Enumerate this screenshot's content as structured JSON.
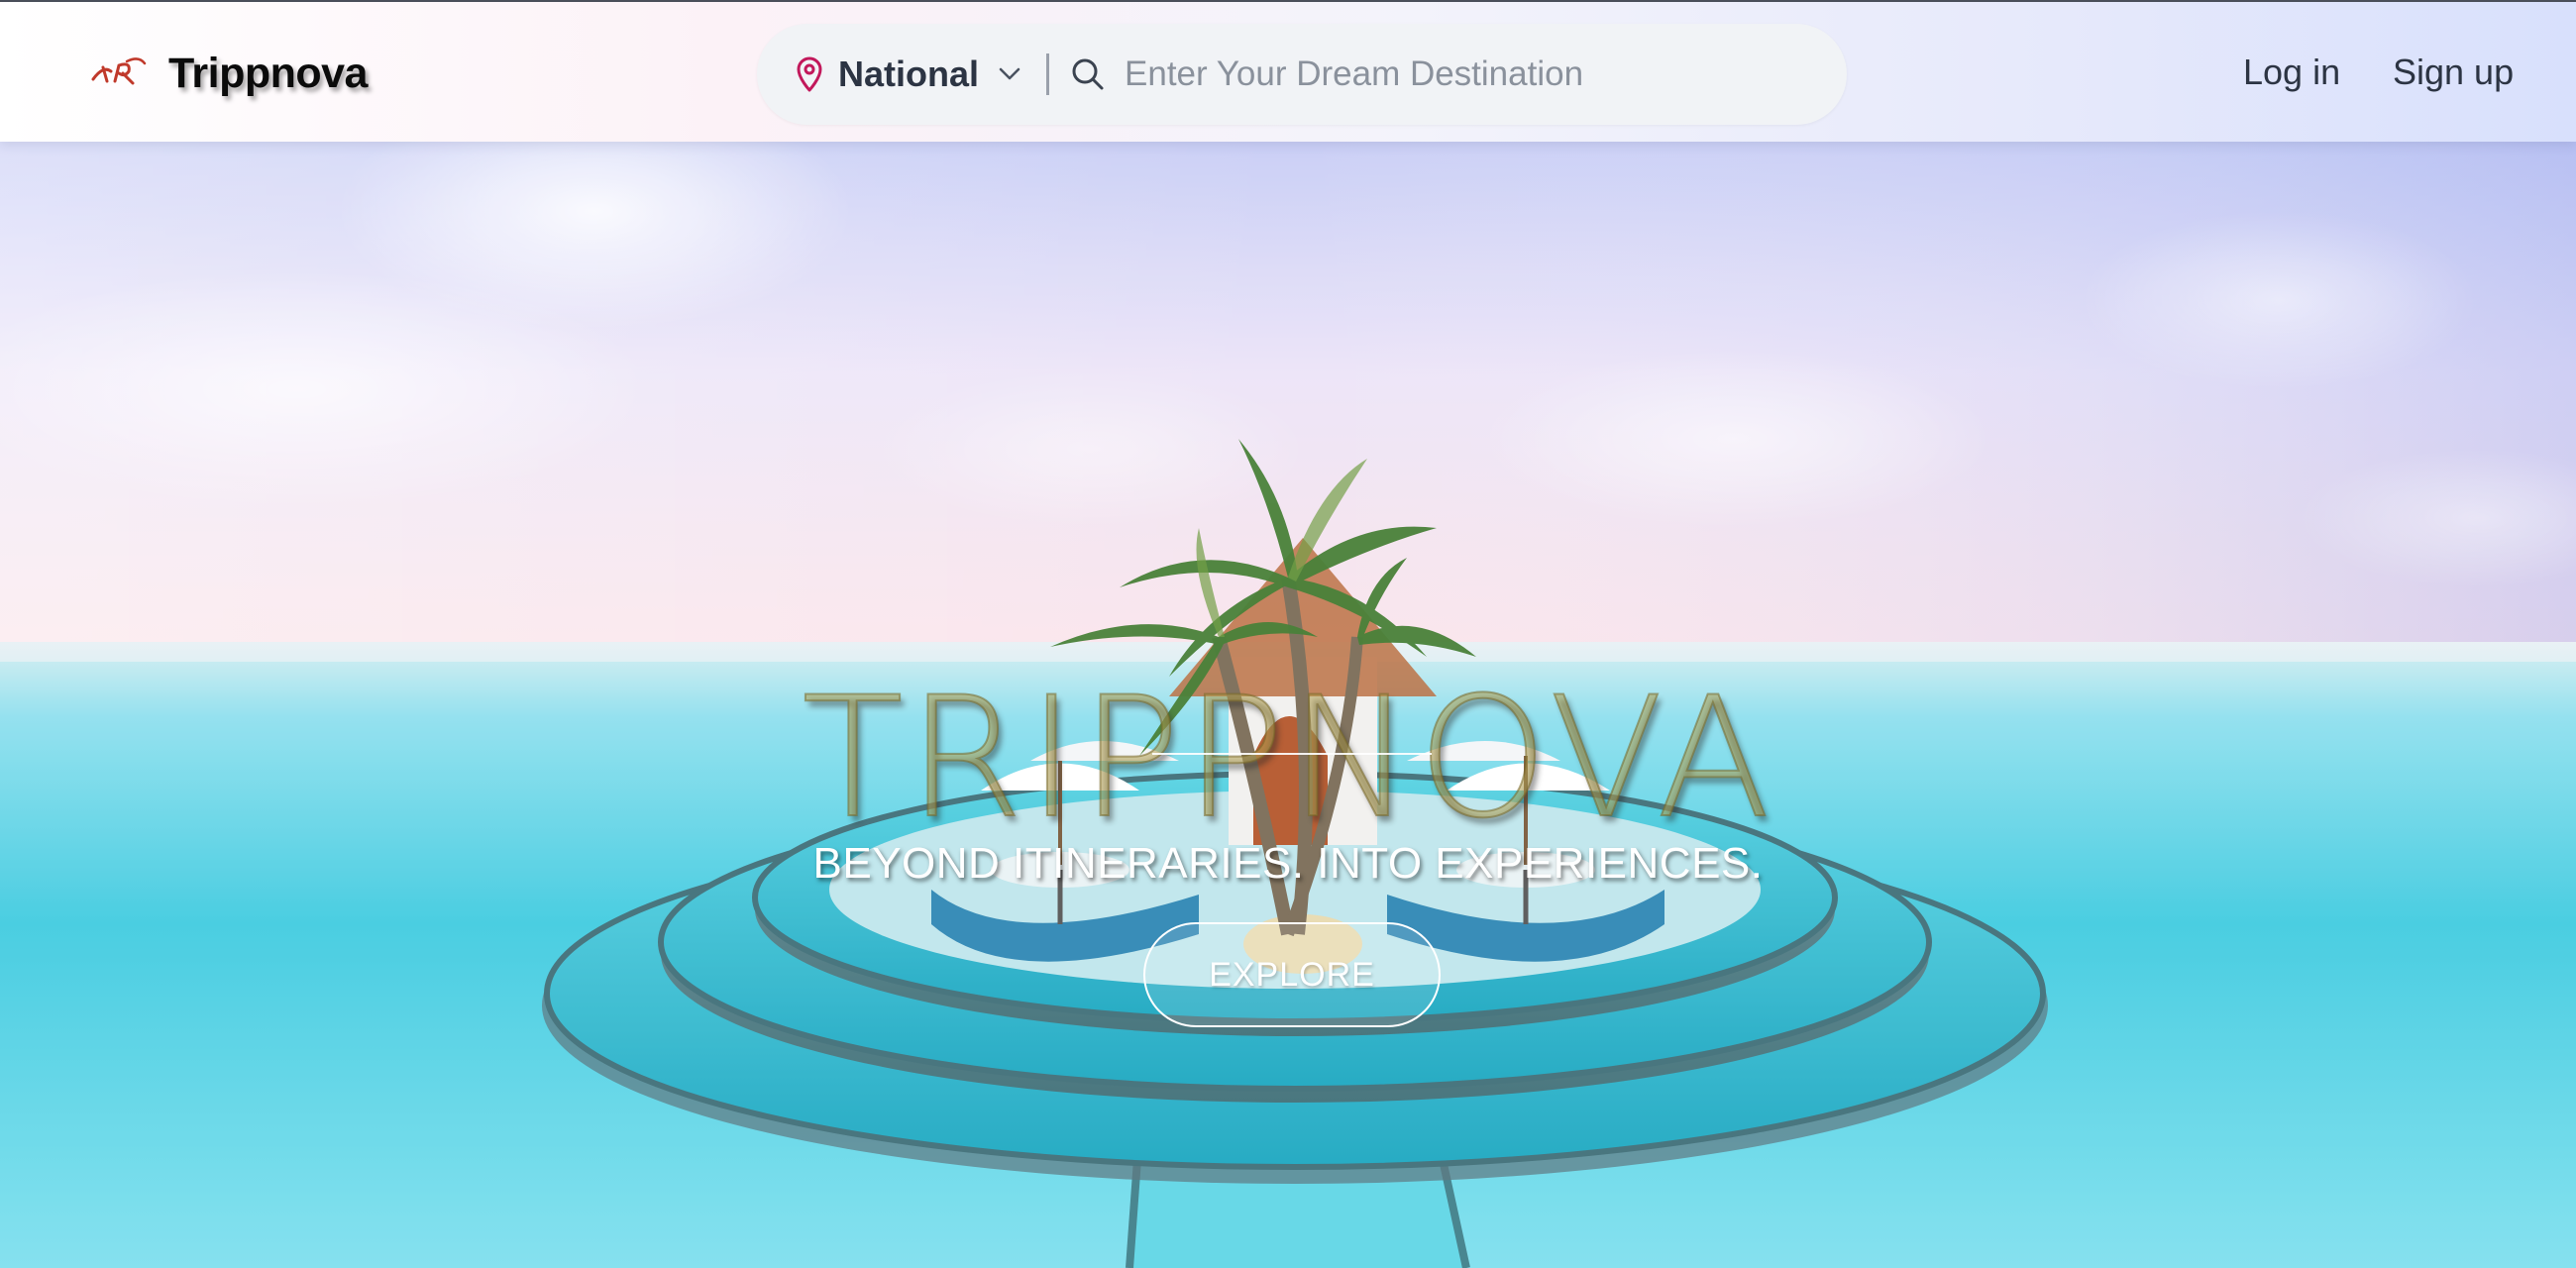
{
  "app": {
    "brand_name": "Trippnova"
  },
  "header": {
    "region_select": {
      "selected": "National",
      "icon": "map-pin-icon"
    },
    "search": {
      "placeholder": "Enter Your Dream Destination",
      "value": "",
      "icon": "search-icon"
    },
    "login_label": "Log in",
    "signup_label": "Sign up"
  },
  "hero": {
    "title": "TRIPPNOVA",
    "tagline": "BEYOND ITINERARIES. INTO EXPERIENCES.",
    "cta_label": "EXPLORE"
  },
  "colors": {
    "brand_logo": "#c0392b",
    "pin_icon": "#c2185b",
    "text_dark": "#2c3443",
    "search_pill_bg": "#f1f3f6",
    "water": "#4fd0e2",
    "sky": "#b9c3f2"
  }
}
